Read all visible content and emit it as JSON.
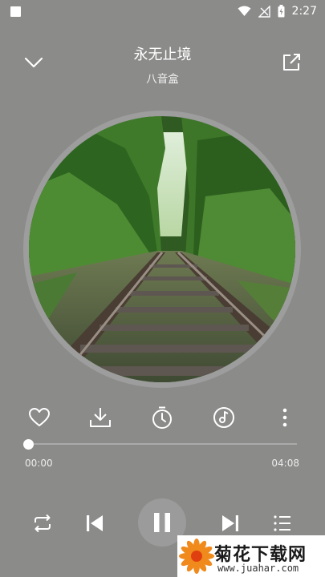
{
  "status_bar": {
    "time": "2:27",
    "icons": [
      "notification-square-icon",
      "wifi-icon",
      "no-signal-icon",
      "battery-charging-icon"
    ]
  },
  "header": {
    "collapse_icon": "chevron-down-icon",
    "share_icon": "open-external-icon",
    "song_title": "永无止境",
    "artist": "八音盒"
  },
  "album": {
    "art_icon": "railway-forest-artwork"
  },
  "actions": [
    "heart-icon",
    "download-icon",
    "timer-icon",
    "music-effect-icon",
    "more-vertical-icon"
  ],
  "progress": {
    "current": "00:00",
    "total": "04:08",
    "fraction": 0.0
  },
  "controls": [
    "repeat-icon",
    "skip-previous-icon",
    "pause-icon",
    "skip-next-icon",
    "playlist-icon"
  ],
  "watermark": {
    "title": "菊花下载网",
    "url": "www.juahar.com"
  }
}
